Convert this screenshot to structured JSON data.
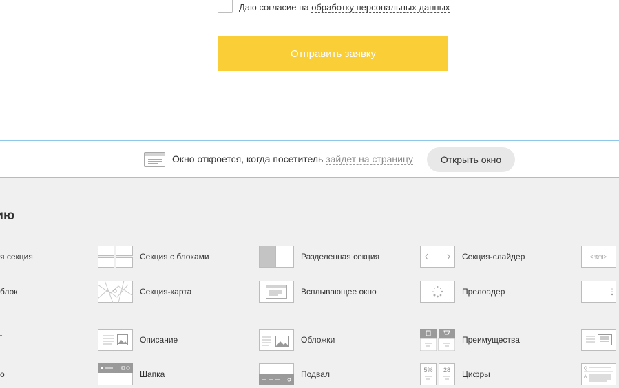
{
  "form": {
    "consent_prefix": "Даю согласие на",
    "consent_link": "обработку персональных данных",
    "submit_label": "Отправить заявку"
  },
  "popup_bar": {
    "text": "Окно откроется, когда посетитель",
    "trigger_link": "зайдет на страницу",
    "open_button": "Открыть окно"
  },
  "panel": {
    "title": "ь секцию",
    "cut_labels": [
      "я секция",
      "блок",
      "о"
    ],
    "items": [
      {
        "label": "Секция с блоками",
        "icon": "blocks-grid-icon"
      },
      {
        "label": "Разделенная секция",
        "icon": "split-section-icon"
      },
      {
        "label": "Секция-слайдер",
        "icon": "slider-icon"
      },
      {
        "label": "Секция-карта",
        "icon": "map-icon"
      },
      {
        "label": "Всплывающее окно",
        "icon": "popup-window-icon"
      },
      {
        "label": "Прелоадер",
        "icon": "preloader-icon"
      },
      {
        "label": "Описание",
        "icon": "description-icon"
      },
      {
        "label": "Обложки",
        "icon": "covers-icon"
      },
      {
        "label": "Преимущества",
        "icon": "advantages-icon"
      },
      {
        "label": "Шапка",
        "icon": "header-icon"
      },
      {
        "label": "Подвал",
        "icon": "footer-icon"
      },
      {
        "label": "Цифры",
        "icon": "numbers-icon"
      }
    ],
    "html_icon_text": "<html>",
    "numbers_icon": {
      "left": "5%",
      "right": "28"
    }
  },
  "colors": {
    "accent_yellow": "#f9ce36",
    "bar_border_blue": "#8fc7ea",
    "panel_bg": "#f0f0f0"
  }
}
